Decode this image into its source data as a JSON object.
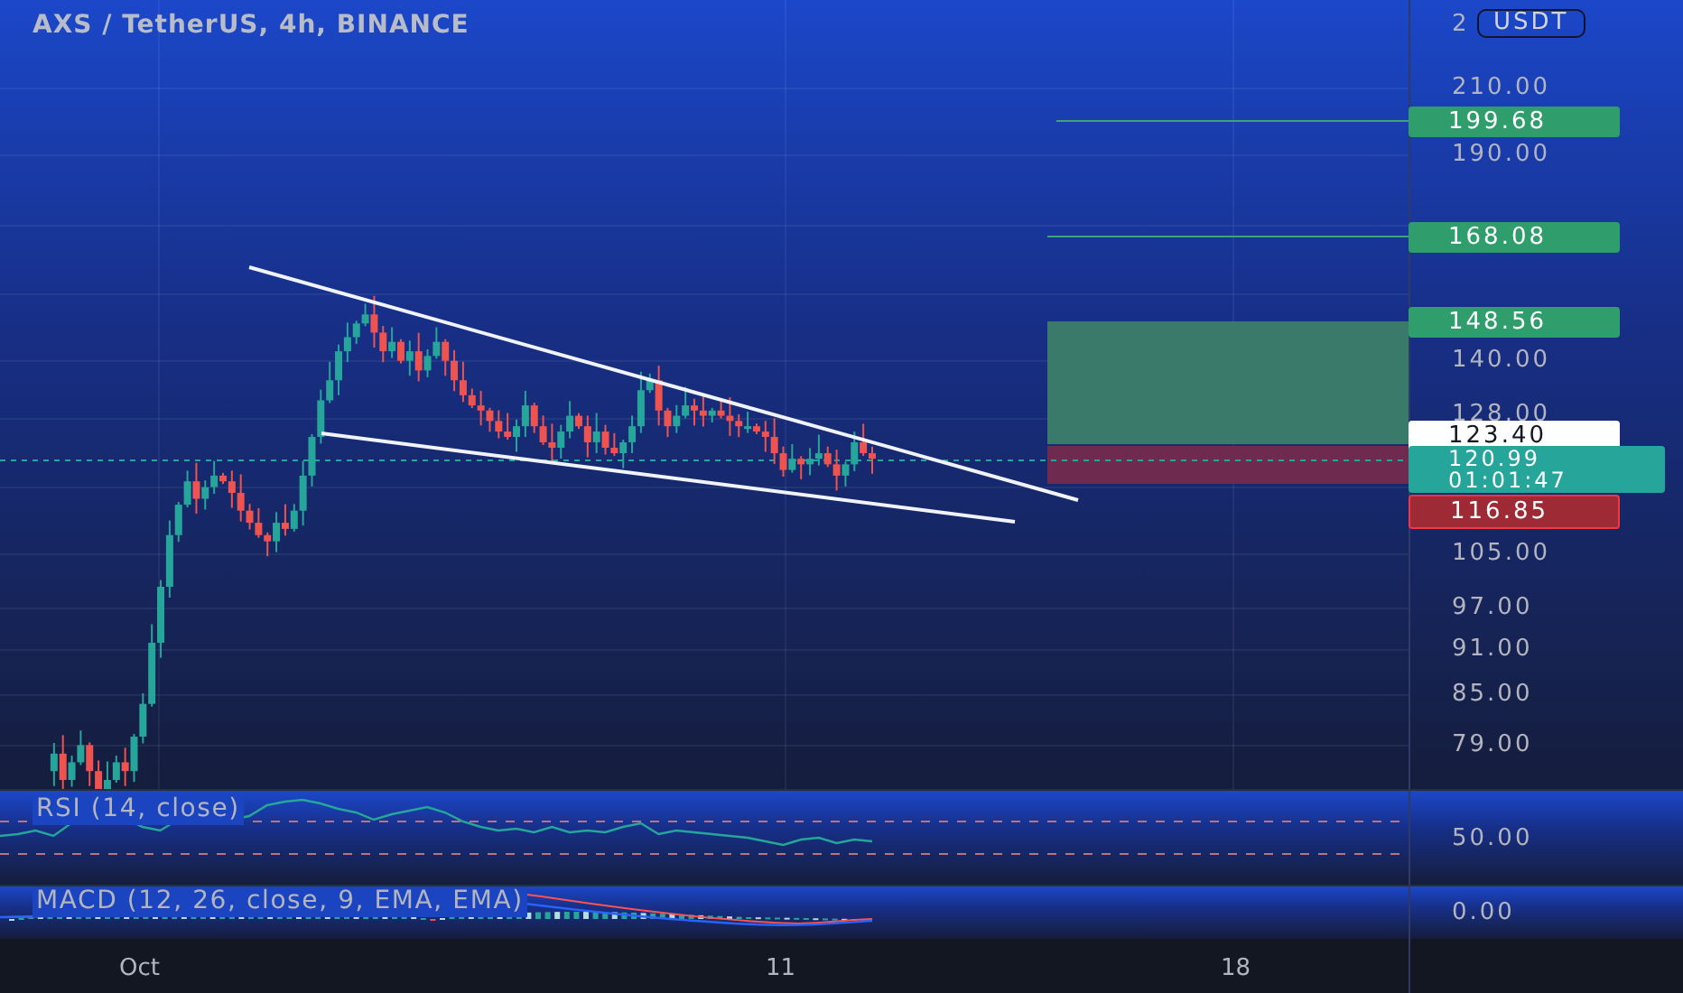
{
  "header": {
    "title": "AXS / TetherUS, 4h, BINANCE"
  },
  "price_axis": {
    "currency": "USDT",
    "labels": [
      "2",
      "210.00",
      "190.00",
      "140.00",
      "128.00",
      "105.00",
      "97.00",
      "91.00",
      "85.00",
      "79.00"
    ]
  },
  "price_tags": [
    {
      "kind": "target",
      "text": "199.68"
    },
    {
      "kind": "target",
      "text": "168.08"
    },
    {
      "kind": "target",
      "text": "148.56"
    },
    {
      "kind": "last",
      "text": "123.40"
    },
    {
      "kind": "current",
      "text": "120.99",
      "countdown": "01:01:47"
    },
    {
      "kind": "stop",
      "text": "116.85"
    }
  ],
  "indicators": [
    {
      "kind": "rsi",
      "title": "RSI (14, close)",
      "axis_label": "50.00"
    },
    {
      "kind": "macd",
      "title": "MACD (12, 26, close, 9, EMA, EMA)",
      "axis_label": "0.00"
    }
  ],
  "time_axis": [
    "Oct",
    "11",
    "18"
  ]
}
